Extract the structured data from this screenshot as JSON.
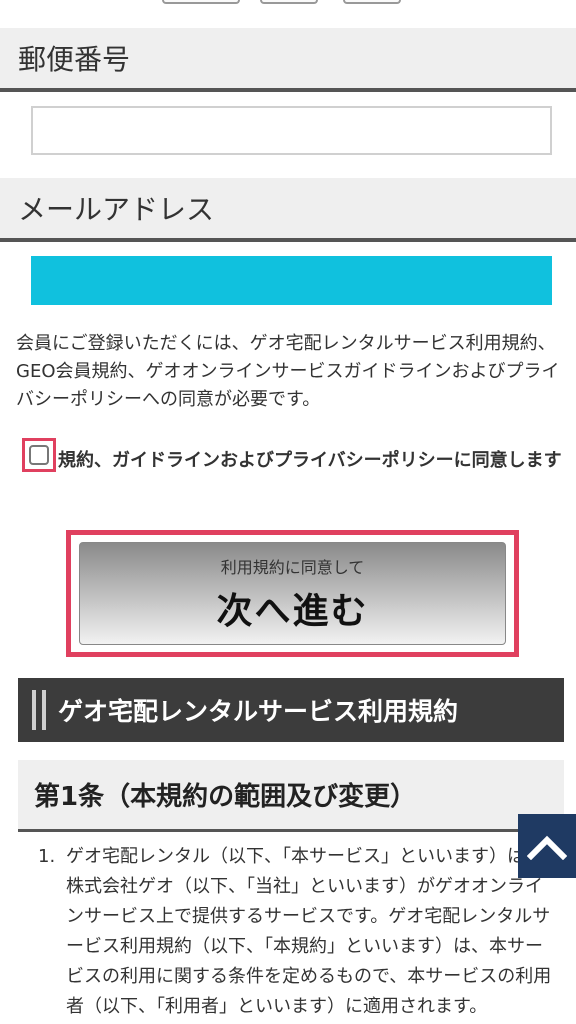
{
  "form": {
    "postal_label": "郵便番号",
    "postal_value": "",
    "email_label": "メールアドレス",
    "email_value": ""
  },
  "notice": "会員にご登録いただくには、ゲオ宅配レンタルサービス利用規約、GEO会員規約、ゲオオンラインサービスガイドラインおよびプライバシーポリシーへの同意が必要です。",
  "agree": {
    "label": "規約、ガイドラインおよびプライバシーポリシーに同意します",
    "checked": false
  },
  "next_button": {
    "sub_label": "利用規約に同意して",
    "main_label": "次へ進む"
  },
  "terms": {
    "title": "ゲオ宅配レンタルサービス利用規約",
    "article_title": "第1条（本規約の範囲及び変更）",
    "clause_number": "1.",
    "clause_text": "ゲオ宅配レンタル（以下、「本サービス」といいます）は、株式会社ゲオ（以下、「当社」といいます）がゲオオンラインサービス上で提供するサービスです。ゲオ宅配レンタルサービス利用規約（以下、「本規約」といいます）は、本サービスの利用に関する条件を定めるもので、本サービスの利用者（以下、「利用者」といいます）に適用されます。"
  },
  "colors": {
    "highlight": "#e0405f",
    "email_fill": "#10c1de",
    "scroll_top_bg": "#1f3a63"
  },
  "icons": {
    "scroll_top": "chevron-up-icon"
  }
}
